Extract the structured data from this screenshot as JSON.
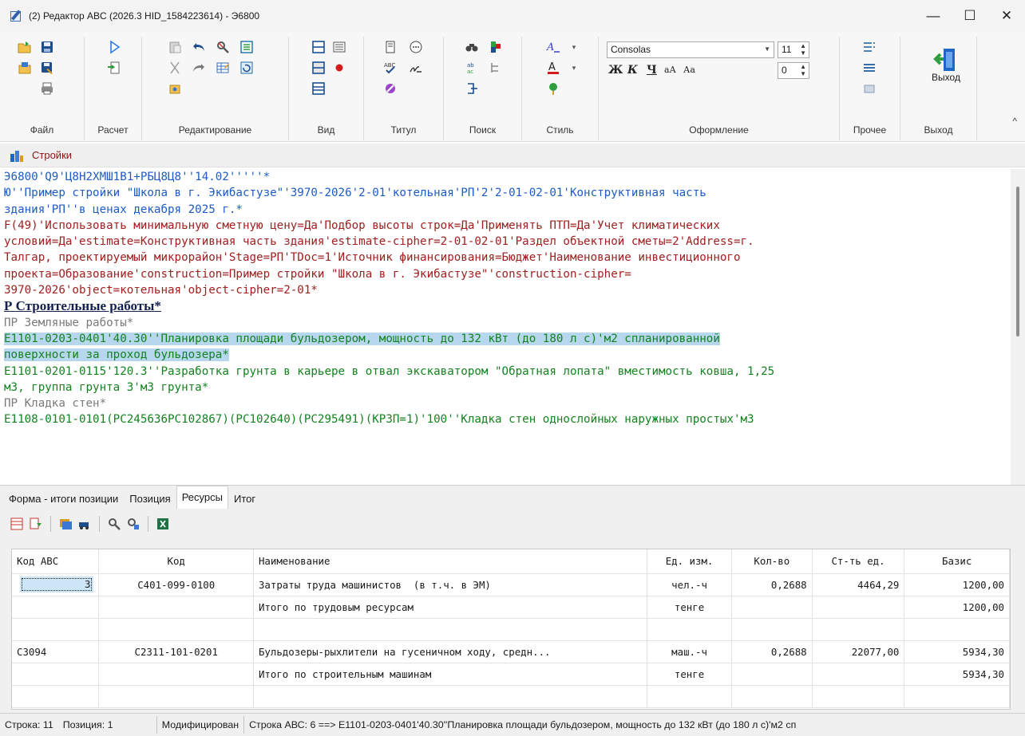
{
  "window": {
    "title": "(2) Редактор ABC (2026.3 HID_1584223614) - Э6800",
    "minimize": "—",
    "maximize": "☐",
    "close": "✕"
  },
  "ribbon": {
    "groups": {
      "file": "Файл",
      "calc": "Расчет",
      "edit": "Редактирование",
      "view": "Вид",
      "title": "Титул",
      "search": "Поиск",
      "style": "Стиль",
      "format": "Оформление",
      "other": "Прочее",
      "exit": "Выход"
    },
    "font_name": "Consolas",
    "font_size": "11",
    "indent": "0",
    "bold": "Ж",
    "italic": "К",
    "underline": "Ч",
    "exit_label": "Выход",
    "collapse": "^"
  },
  "breadcrumb": {
    "label": "Стройки"
  },
  "editor": {
    "lines": {
      "l1": "Э6800'Q9'Ц8Н2ХМШ1В1+РБЦ8Ц8''14.02'''''*",
      "l2": "Ю''Пример стройки \"Школа в г. Экибастузе\"'3970-2026'2-01'котельная'РП'2'2-01-02-01'Конструктивная часть",
      "l3": "здания'РП''в ценах декабря 2025 г.*",
      "l4": "F(49)'Использовать минимальную сметную цену=Да'Подбор высоты строк=Да'Применять ПТП=Да'Учет климатических",
      "l5": "условий=Да'estimate=Конструктивная часть здания'estimate-cipher=2-01-02-01'Раздел объектной сметы=2'Address=г.",
      "l6": "Талгар, проектируемый микрорайон'Stage=РП'TDoc=1'Источник финансирования=Бюджет'Наименование инвестиционного",
      "l7": "проекта=Образование'construction=Пример стройки \"Школа в г. Экибастузе\"'construction-cipher=",
      "l8": "3970-2026'object=котельная'object-cipher=2-01*",
      "l9": "Р Строительные работы*",
      "l10": "ПР Земляные работы*",
      "l11": "Е1101-0203-0401'40.30''Планировка площади бульдозером, мощность до 132 кВт (до 180 л с)'м2 спланированной",
      "l12": "поверхности за проход бульдозера*",
      "l13": "Е1101-0201-0115'120.3''Разработка грунта в карьере в отвал экскаватором \"Обратная лопата\" вместимость ковша, 1,25",
      "l14": "м3, группа грунта 3'м3 грунта*",
      "l15": "ПР Кладка стен*",
      "l16": "Е1108-0101-0101(РС245636РС102867)(РС102640)(РС295491)(КРЗП=1)'100''Кладка стен однослойных наружных простых'м3"
    }
  },
  "tabs": [
    "Форма - итоги позиции",
    "Позиция",
    "Ресурсы",
    "Итог"
  ],
  "grid": {
    "columns": [
      "Код АВС",
      "Код",
      "Наименование",
      "Ед. изм.",
      "Кол-во",
      "Ст-ть ед.",
      "Базис"
    ],
    "rows": [
      [
        "3",
        "С401-099-0100",
        "Затраты труда машинистов  (в т.ч. в ЭМ)",
        "чел.-ч",
        "0,2688",
        "4464,29",
        "1200,00"
      ],
      [
        "",
        "",
        "Итого по трудовым ресурсам",
        "тенге",
        "",
        "",
        "1200,00"
      ],
      [
        "",
        "",
        "",
        "",
        "",
        "",
        ""
      ],
      [
        "С3094",
        "С2311-101-0201",
        "Бульдозеры-рыхлители на гусеничном ходу, средн...",
        "маш.-ч",
        "0,2688",
        "22077,00",
        "5934,30"
      ],
      [
        "",
        "",
        "Итого по строительным машинам",
        "тенге",
        "",
        "",
        "5934,30"
      ],
      [
        "",
        "",
        "",
        "",
        "",
        "",
        ""
      ]
    ]
  },
  "status": {
    "row": "Строка: 11",
    "position": "Позиция: 1",
    "modified": "Модифицирован",
    "abc_row": "Строка АВС:  6 ==> Е1101-0203-0401'40.30''Планировка площади бульдозером, мощность до 132 кВт (до 180 л с)'м2 сп"
  },
  "colors": {
    "accent": "#1d5bc7",
    "param": "#a02020",
    "item": "#14821f",
    "selection": "#b7d7ef"
  }
}
